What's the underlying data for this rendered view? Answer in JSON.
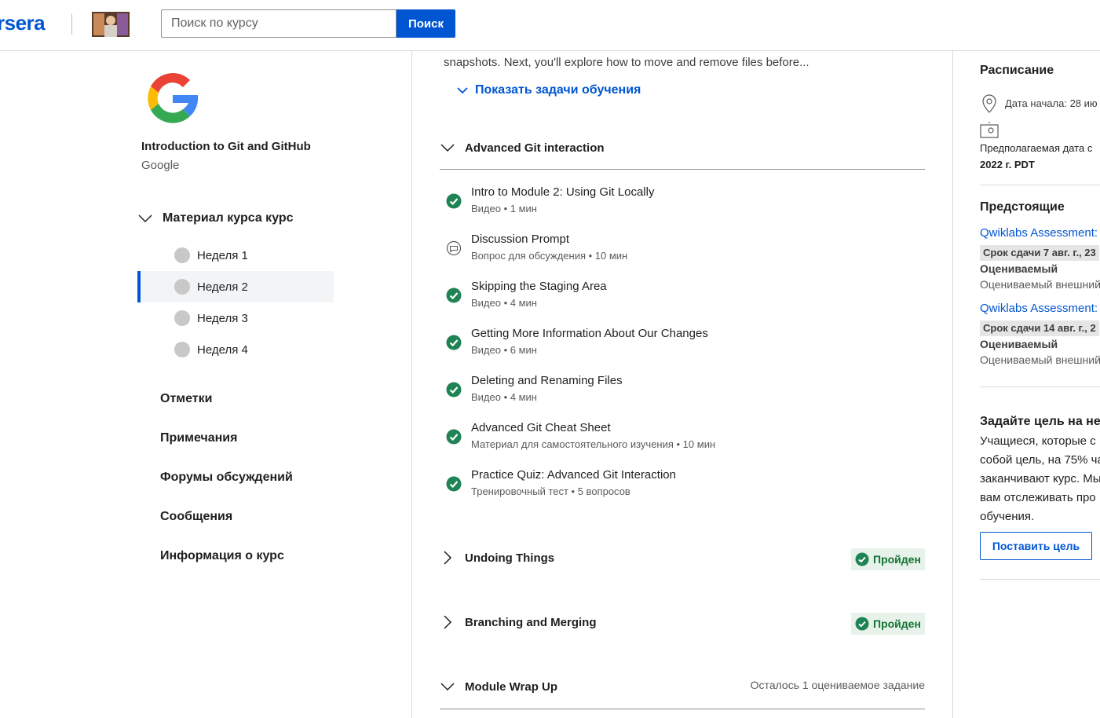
{
  "header": {
    "logo_text": "rsera",
    "search_placeholder": "Поиск по курсу",
    "search_button": "Поиск"
  },
  "sidebar": {
    "course_title": "Introduction to Git and GitHub",
    "course_org": "Google",
    "material_label": "Материал курса курс",
    "weeks": [
      {
        "label": "Неделя 1",
        "active": false
      },
      {
        "label": "Неделя 2",
        "active": true
      },
      {
        "label": "Неделя 3",
        "active": false
      },
      {
        "label": "Неделя 4",
        "active": false
      }
    ],
    "nav": [
      "Отметки",
      "Примечания",
      "Форумы обсуждений",
      "Сообщения",
      "Информация о курс"
    ]
  },
  "main": {
    "intro_text": "snapshots. Next, you'll explore how to move and remove files before...",
    "show_objectives": "Показать задачи обучения",
    "modules": [
      {
        "title": "Advanced Git interaction",
        "lessons": [
          {
            "title": "Intro to Module 2: Using Git Locally",
            "meta": "Видео • 1 мин",
            "icon": "check-circle-icon"
          },
          {
            "title": "Discussion Prompt",
            "meta": "Вопрос для обсуждения • 10 мин",
            "icon": "discussion-icon"
          },
          {
            "title": "Skipping the Staging Area",
            "meta": "Видео • 4 мин",
            "icon": "check-circle-icon"
          },
          {
            "title": "Getting More Information About Our Changes",
            "meta": "Видео • 6 мин",
            "icon": "check-circle-icon"
          },
          {
            "title": "Deleting and Renaming Files",
            "meta": "Видео • 4 мин",
            "icon": "check-circle-icon"
          },
          {
            "title": "Advanced Git Cheat Sheet",
            "meta": "Материал для самостоятельного изучения • 10 мин",
            "icon": "check-circle-icon"
          },
          {
            "title": "Practice Quiz: Advanced Git Interaction",
            "meta": "Тренировочный тест • 5 вопросов",
            "icon": "check-circle-icon"
          }
        ]
      },
      {
        "title": "Undoing Things",
        "badge": "Пройден"
      },
      {
        "title": "Branching and Merging",
        "badge": "Пройден"
      },
      {
        "title": "Module Wrap Up",
        "note": "Осталось 1 оцениваемое задание"
      }
    ]
  },
  "right": {
    "schedule_heading": "Расписание",
    "start_date": "Дата начала: 28 ию",
    "estimated_end_line1": "Предполагаемая дата с",
    "estimated_end_line2": "2022 г. PDT",
    "upcoming_heading": "Предстоящие",
    "upcoming": [
      {
        "title": "Qwiklabs Assessment:",
        "due": "Срок сдачи 7 авг. г., 23",
        "graded": "Оцениваемый",
        "kind": "Оцениваемый внешний"
      },
      {
        "title": "Qwiklabs Assessment:",
        "due": "Срок сдачи 14 авг. г., 2",
        "graded": "Оцениваемый",
        "kind": "Оцениваемый внешний"
      }
    ],
    "goal_heading": "Задайте цель на нед",
    "goal_lines": [
      "Учащиеся, которые с",
      "собой цель, на 75% ча",
      "заканчивают курс. Мы",
      "вам отслеживать про",
      "обучения."
    ],
    "goal_button": "Поставить цель"
  },
  "colors": {
    "brand_blue": "#0056d2",
    "complete_green": "#1f8354",
    "badge_bg": "#e6f2ea"
  }
}
